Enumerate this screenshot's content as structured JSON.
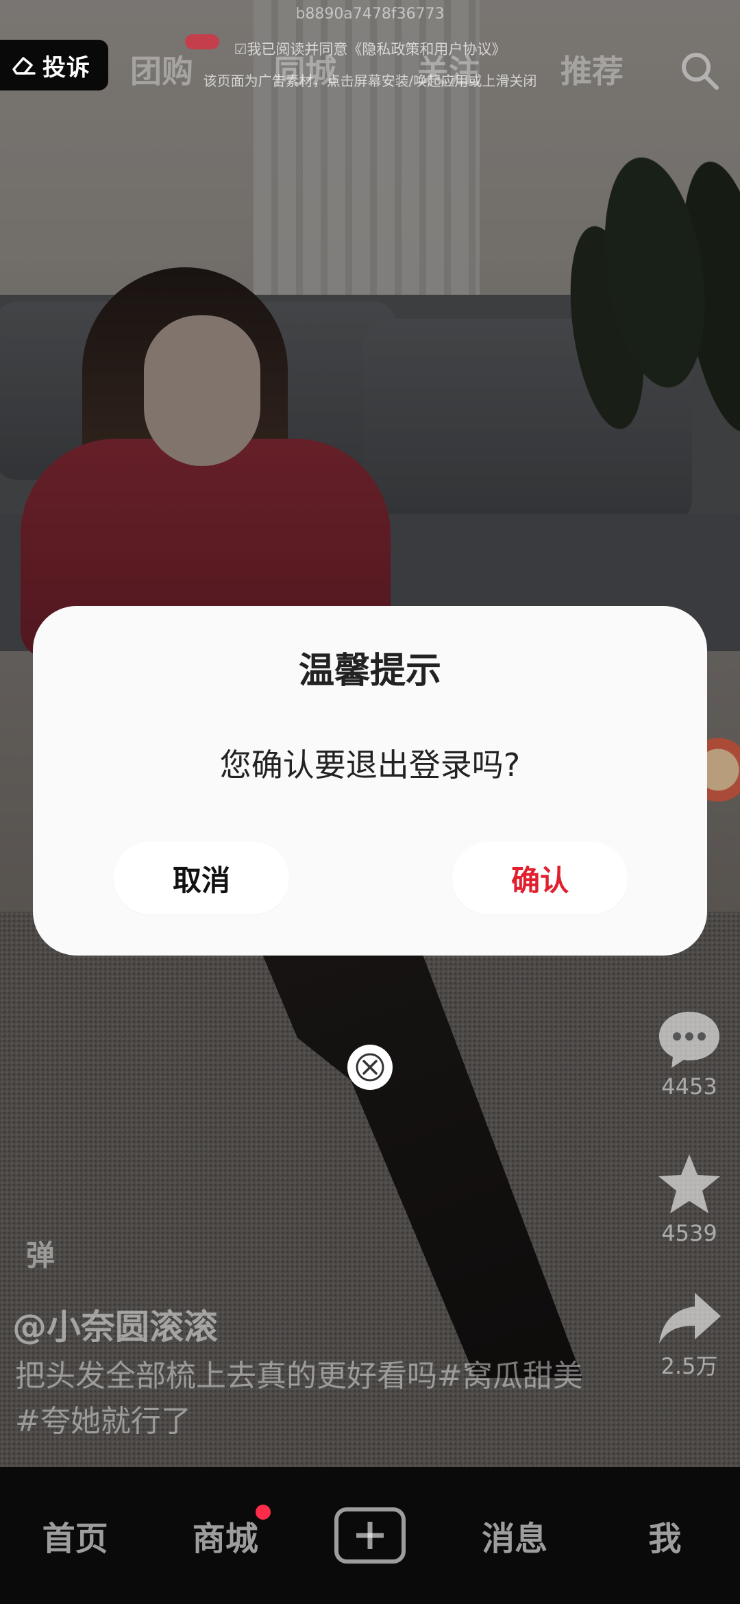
{
  "overlay": {
    "complaint_label": "投诉",
    "ad_id": "b8890a7478f36773",
    "agreement_text": "☑我已阅读并同意《隐私政策和用户协议》",
    "ad_tip": "该页面为广告素材，点击屏幕安装/唤起应用或上滑关闭",
    "top_tabs": [
      "团购",
      "同城",
      "关注",
      "推荐"
    ]
  },
  "side_actions": {
    "comments_count": "4453",
    "favorites_count": "4539",
    "shares_count": "2.5万"
  },
  "video": {
    "danmu_label": "弹",
    "author": "@小奈圆滚滚",
    "caption": "把头发全部梳上去真的更好看吗#窝瓜甜美#夸她就行了"
  },
  "bottom_nav": {
    "items": [
      "首页",
      "商城",
      "消息",
      "我"
    ]
  },
  "dialog": {
    "title": "温馨提示",
    "message": "您确认要退出登录吗?",
    "cancel_label": "取消",
    "confirm_label": "确认"
  },
  "colors": {
    "confirm": "#e0202e",
    "badge": "#ff2c4a",
    "dialog_bg": "#fafafa"
  }
}
